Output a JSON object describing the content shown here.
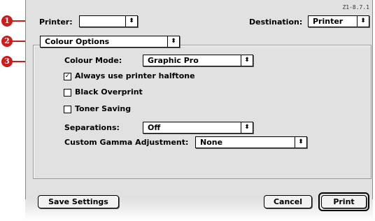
{
  "version": "Z1-8.7.1",
  "printer": {
    "label": "Printer:",
    "value": ""
  },
  "destination": {
    "label": "Destination:",
    "value": "Printer"
  },
  "panel_menu": {
    "value": "Colour Options"
  },
  "colour_mode": {
    "label": "Colour Mode:",
    "value": "Graphic Pro"
  },
  "options": {
    "halftone": {
      "label": "Always use printer halftone",
      "checked": true,
      "mark": "✓"
    },
    "black_overprint": {
      "label": "Black Overprint",
      "checked": false,
      "mark": ""
    },
    "toner_saving": {
      "label": "Toner Saving",
      "checked": false,
      "mark": ""
    }
  },
  "separations": {
    "label": "Separations:",
    "value": "Off"
  },
  "gamma": {
    "label": "Custom Gamma Adjustment:",
    "value": "None"
  },
  "buttons": {
    "save": "Save Settings",
    "cancel": "Cancel",
    "print": "Print"
  },
  "callouts": [
    "1",
    "2",
    "3"
  ],
  "popup_arrow_glyph": "⬍",
  "colors": {
    "callout": "#d11a1a",
    "window": "#e1e1e1"
  }
}
